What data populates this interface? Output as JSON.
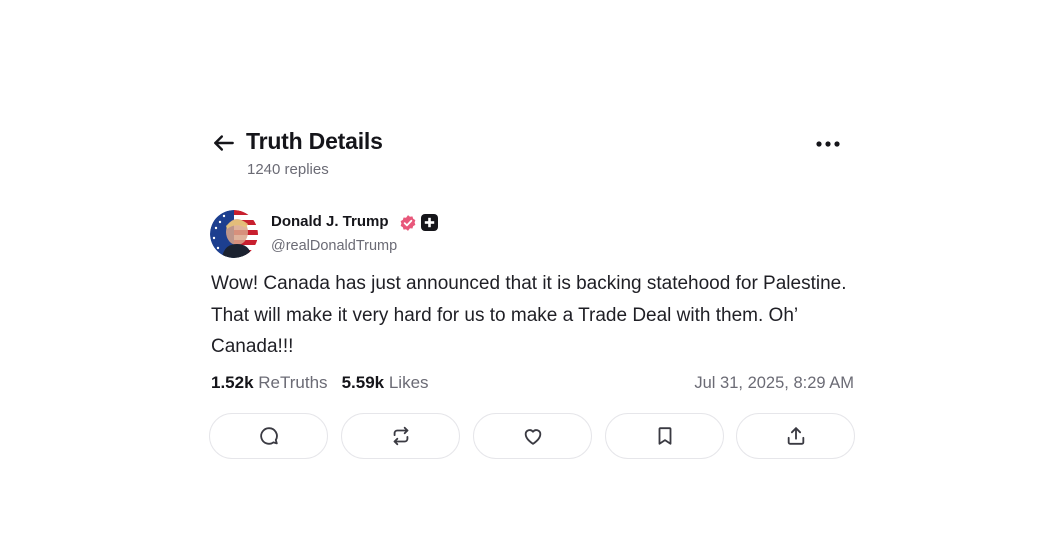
{
  "header": {
    "title": "Truth Details",
    "subtitle": "1240 replies"
  },
  "post": {
    "author": {
      "name": "Donald J. Trump",
      "handle": "@realDonaldTrump"
    },
    "text": "Wow! Canada has just announced that it is backing statehood for Palestine. That will make it very hard for us to make a Trade Deal with them. Oh’ Canada!!!",
    "stats": {
      "retruths_count": "1.52k",
      "retruths_label": "ReTruths",
      "likes_count": "5.59k",
      "likes_label": "Likes"
    },
    "timestamp": "Jul 31, 2025, 8:29 AM"
  },
  "icons": {
    "back": "arrow-left-icon",
    "more": "ellipsis-icon",
    "verified": "verified-badge-icon",
    "plus": "plus-badge-icon",
    "reply": "reply-icon",
    "retruth": "retruth-icon",
    "like": "heart-icon",
    "bookmark": "bookmark-icon",
    "share": "share-icon"
  },
  "colors": {
    "verified_badge": "#e8577a",
    "text_primary": "#15151a",
    "text_secondary": "#6b6b75",
    "button_border": "#e6e6ea"
  }
}
